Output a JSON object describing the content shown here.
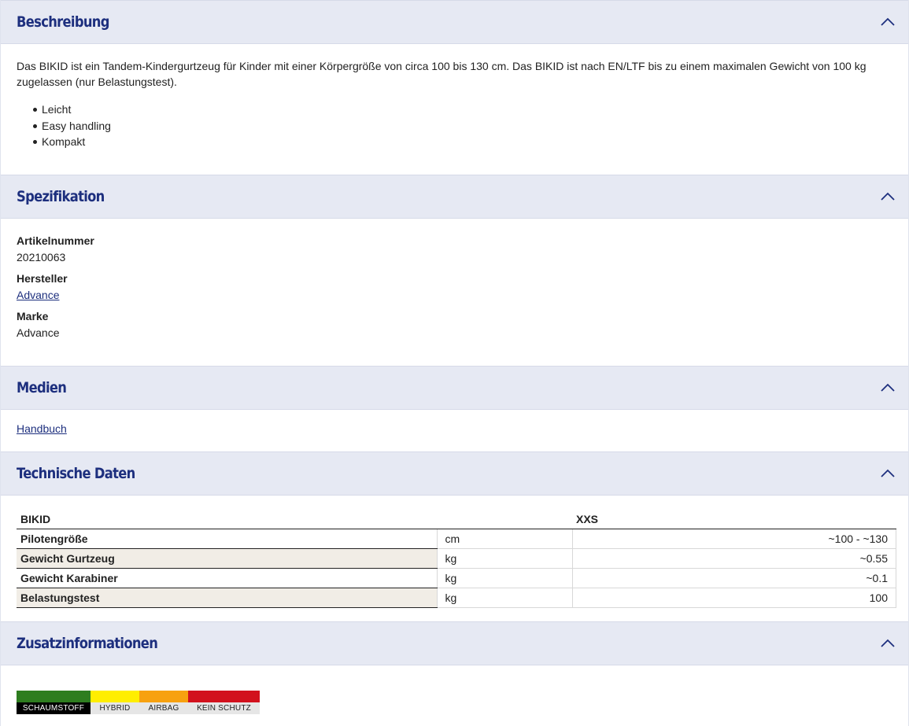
{
  "sections": {
    "beschreibung": {
      "title": "Beschreibung",
      "text": "Das BIKID ist ein Tandem-Kindergurtzeug für Kinder mit einer Körpergröße von circa 100 bis 130 cm. Das BIKID ist nach EN/LTF bis zu einem maximalen Gewicht von 100 kg zugelassen (nur Belastungstest).",
      "bullets": [
        "Leicht",
        "Easy handling",
        "Kompakt"
      ]
    },
    "spezifikation": {
      "title": "Spezifikation",
      "artikelnummer_label": "Artikelnummer",
      "artikelnummer": "20210063",
      "hersteller_label": "Hersteller",
      "hersteller": "Advance",
      "marke_label": "Marke",
      "marke": "Advance"
    },
    "medien": {
      "title": "Medien",
      "link": "Handbuch"
    },
    "technik": {
      "title": "Technische Daten",
      "header_model": "BIKID",
      "header_size": "XXS",
      "rows": [
        {
          "name": "Pilotengröße",
          "unit": "cm",
          "value": "~100 - ~130"
        },
        {
          "name": "Gewicht Gurtzeug",
          "unit": "kg",
          "value": "~0.55"
        },
        {
          "name": "Gewicht Karabiner",
          "unit": "kg",
          "value": "~0.1"
        },
        {
          "name": "Belastungstest",
          "unit": "kg",
          "value": "100"
        }
      ]
    },
    "zusatz": {
      "title": "Zusatzinformationen",
      "legend": [
        {
          "label": "SCHAUMSTOFF",
          "color": "#2e7d1f"
        },
        {
          "label": "HYBRID",
          "color": "#ffee00"
        },
        {
          "label": "AIRBAG",
          "color": "#f7a10f"
        },
        {
          "label": "KEIN SCHUTZ",
          "color": "#d2111d"
        }
      ]
    }
  },
  "icons": {
    "collapse": "chevron-up-icon"
  },
  "colors": {
    "accent": "#1d2f7e",
    "header_bg": "#e6e9f3"
  }
}
